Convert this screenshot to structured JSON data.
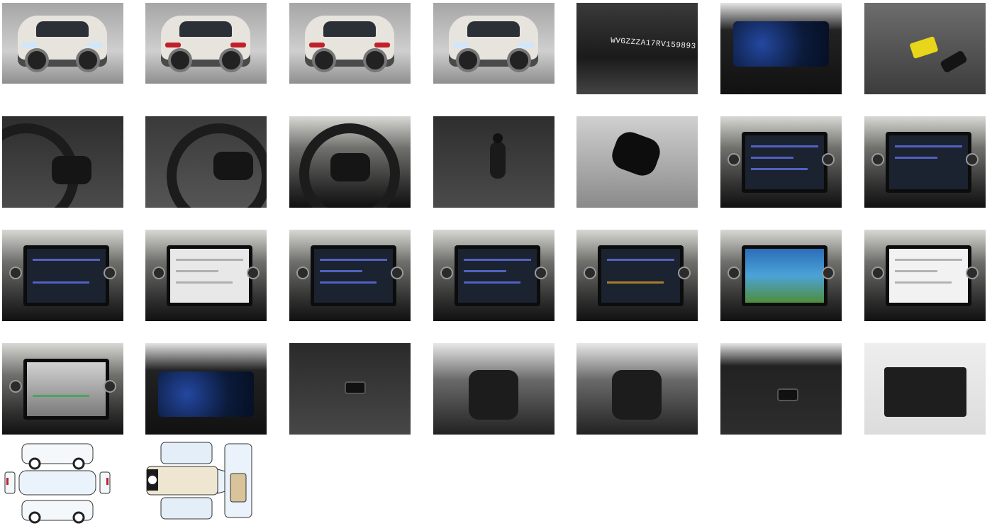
{
  "gallery": {
    "vin_plate_text": "WVGZZZA17RV159893",
    "photos": [
      {
        "id": "exterior-front-left",
        "icon": "car-front-icon"
      },
      {
        "id": "exterior-rear-left",
        "icon": "car-rear-icon"
      },
      {
        "id": "exterior-rear-right",
        "icon": "car-rear-icon"
      },
      {
        "id": "exterior-front-right",
        "icon": "car-front-icon"
      },
      {
        "id": "vin-plate",
        "icon": "vin-icon"
      },
      {
        "id": "instrument-cluster",
        "icon": "dashboard-icon"
      },
      {
        "id": "key-and-tag",
        "icon": "key-icon"
      }
    ],
    "diagram_labels": [
      "exterior-damage-diagram",
      "interior-damage-diagram"
    ]
  }
}
